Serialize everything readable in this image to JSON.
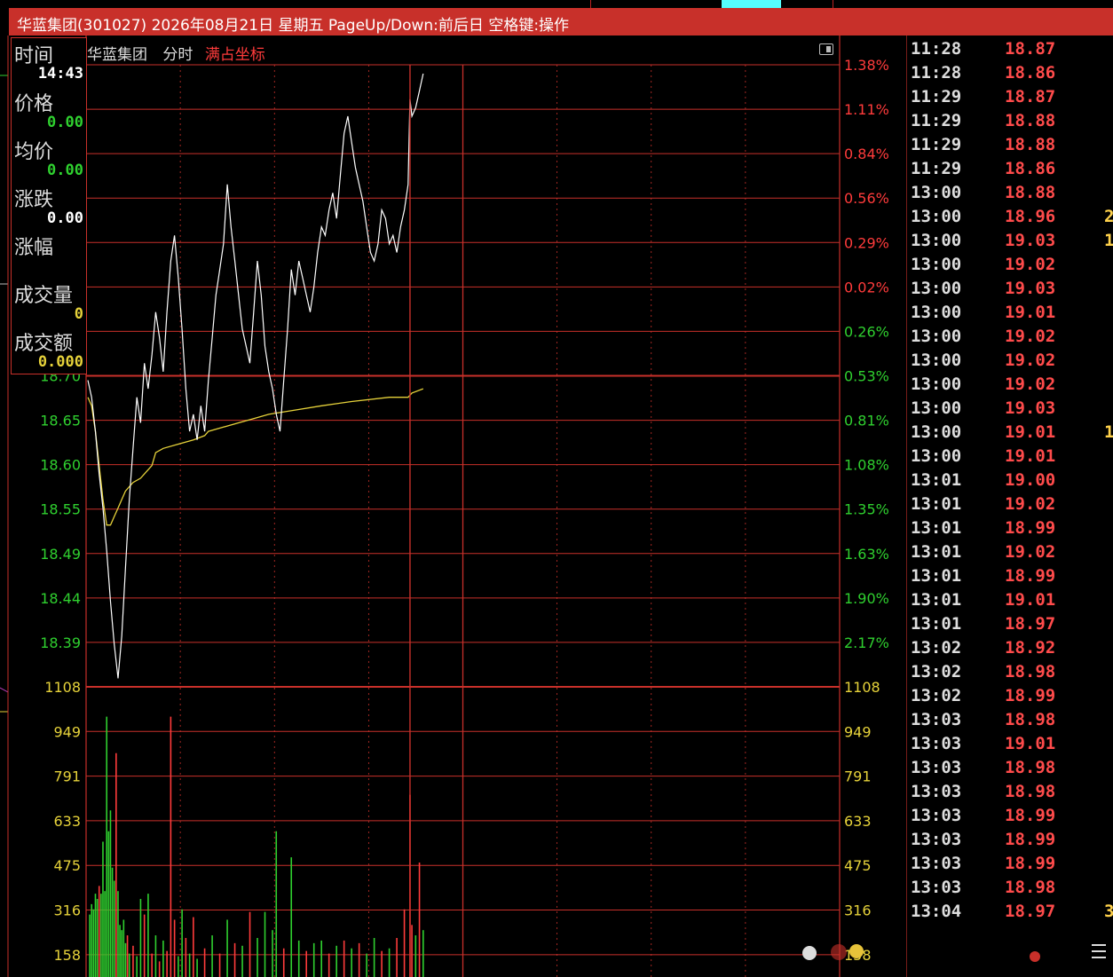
{
  "window": {
    "title": "华蓝集团(301027) 2026年08月21日 星期五 PageUp/Down:前后日 空格键:操作"
  },
  "header": {
    "close_glyph": "×",
    "stock_name": "华蓝集团",
    "view_mode": "分时",
    "coord_mode": "满占坐标"
  },
  "info_panel": {
    "time_label": "时间",
    "time_value": "14:43",
    "price_label": "价格",
    "price_value": "0.00",
    "avg_label": "均价",
    "avg_value": "0.00",
    "change_label": "涨跌",
    "change_value": "0.00",
    "pct_label": "涨幅",
    "pct_value": "",
    "volume_label": "成交量",
    "volume_value": "0",
    "amount_label": "成交额",
    "amount_value": "0.000"
  },
  "colors": {
    "grid": "#c8302a",
    "price_line": "#ffffff",
    "avg_line": "#e6d23a",
    "up": "#ff3b3b",
    "down": "#2fd02f",
    "axis_text_green": "#2fd02f",
    "axis_text_yellow": "#e6d23a",
    "axis_text_red": "#ff3b3b"
  },
  "chart_data": {
    "type": "line",
    "price_axis_left": [
      "18.70",
      "18.65",
      "18.60",
      "18.55",
      "18.49",
      "18.44",
      "18.39"
    ],
    "pct_axis_right_up": [
      "1.38%",
      "1.11%",
      "0.84%",
      "0.56%",
      "0.29%",
      "0.02%"
    ],
    "pct_axis_right_down": [
      "0.26%",
      "0.53%",
      "0.81%",
      "1.08%",
      "1.35%",
      "1.63%",
      "1.90%",
      "2.17%"
    ],
    "volume_axis": [
      "1108",
      "949",
      "791",
      "633",
      "475",
      "316",
      "158"
    ],
    "price_range": [
      18.36,
      19.08
    ],
    "volume_range": [
      0,
      1108
    ],
    "price_series": [
      [
        0,
        18.72
      ],
      [
        2,
        18.7
      ],
      [
        4,
        18.66
      ],
      [
        6,
        18.61
      ],
      [
        8,
        18.57
      ],
      [
        10,
        18.52
      ],
      [
        12,
        18.46
      ],
      [
        14,
        18.41
      ],
      [
        16,
        18.37
      ],
      [
        18,
        18.42
      ],
      [
        20,
        18.5
      ],
      [
        22,
        18.58
      ],
      [
        24,
        18.64
      ],
      [
        26,
        18.7
      ],
      [
        28,
        18.67
      ],
      [
        30,
        18.74
      ],
      [
        32,
        18.71
      ],
      [
        34,
        18.75
      ],
      [
        36,
        18.8
      ],
      [
        38,
        18.77
      ],
      [
        40,
        18.73
      ],
      [
        42,
        18.8
      ],
      [
        44,
        18.86
      ],
      [
        46,
        18.89
      ],
      [
        48,
        18.84
      ],
      [
        50,
        18.78
      ],
      [
        52,
        18.71
      ],
      [
        54,
        18.66
      ],
      [
        56,
        18.68
      ],
      [
        58,
        18.65
      ],
      [
        60,
        18.69
      ],
      [
        62,
        18.66
      ],
      [
        64,
        18.72
      ],
      [
        66,
        18.77
      ],
      [
        68,
        18.82
      ],
      [
        70,
        18.85
      ],
      [
        72,
        18.88
      ],
      [
        74,
        18.95
      ],
      [
        76,
        18.9
      ],
      [
        78,
        18.86
      ],
      [
        80,
        18.82
      ],
      [
        82,
        18.78
      ],
      [
        84,
        18.76
      ],
      [
        86,
        18.74
      ],
      [
        88,
        18.8
      ],
      [
        90,
        18.86
      ],
      [
        92,
        18.82
      ],
      [
        94,
        18.76
      ],
      [
        96,
        18.73
      ],
      [
        98,
        18.71
      ],
      [
        100,
        18.68
      ],
      [
        102,
        18.66
      ],
      [
        104,
        18.72
      ],
      [
        106,
        18.78
      ],
      [
        108,
        18.85
      ],
      [
        110,
        18.82
      ],
      [
        112,
        18.86
      ],
      [
        114,
        18.84
      ],
      [
        116,
        18.82
      ],
      [
        118,
        18.8
      ],
      [
        120,
        18.83
      ],
      [
        122,
        18.87
      ],
      [
        124,
        18.9
      ],
      [
        126,
        18.89
      ],
      [
        128,
        18.92
      ],
      [
        130,
        18.94
      ],
      [
        132,
        18.91
      ],
      [
        134,
        18.96
      ],
      [
        136,
        19.01
      ],
      [
        138,
        19.03
      ],
      [
        140,
        19.0
      ],
      [
        142,
        18.97
      ],
      [
        144,
        18.95
      ],
      [
        146,
        18.93
      ],
      [
        148,
        18.9
      ],
      [
        150,
        18.87
      ],
      [
        152,
        18.86
      ],
      [
        154,
        18.88
      ],
      [
        156,
        18.92
      ],
      [
        158,
        18.91
      ],
      [
        160,
        18.88
      ],
      [
        162,
        18.89
      ],
      [
        164,
        18.87
      ],
      [
        166,
        18.9
      ],
      [
        168,
        18.92
      ],
      [
        170,
        18.95
      ],
      [
        171,
        19.05
      ],
      [
        172,
        19.03
      ],
      [
        174,
        19.04
      ],
      [
        176,
        19.06
      ],
      [
        178,
        19.08
      ]
    ],
    "avg_series": [
      [
        0,
        18.7
      ],
      [
        2,
        18.69
      ],
      [
        4,
        18.66
      ],
      [
        6,
        18.62
      ],
      [
        8,
        18.58
      ],
      [
        10,
        18.55
      ],
      [
        12,
        18.55
      ],
      [
        14,
        18.56
      ],
      [
        16,
        18.57
      ],
      [
        18,
        18.58
      ],
      [
        20,
        18.59
      ],
      [
        24,
        18.6
      ],
      [
        28,
        18.605
      ],
      [
        30,
        18.61
      ],
      [
        34,
        18.62
      ],
      [
        36,
        18.635
      ],
      [
        40,
        18.64
      ],
      [
        48,
        18.645
      ],
      [
        56,
        18.65
      ],
      [
        62,
        18.655
      ],
      [
        64,
        18.66
      ],
      [
        72,
        18.665
      ],
      [
        80,
        18.67
      ],
      [
        88,
        18.675
      ],
      [
        96,
        18.68
      ],
      [
        110,
        18.685
      ],
      [
        124,
        18.69
      ],
      [
        140,
        18.695
      ],
      [
        160,
        18.7
      ],
      [
        170,
        18.7
      ],
      [
        172,
        18.705
      ],
      [
        178,
        18.71
      ]
    ],
    "volume_bars": [
      [
        1,
        240,
        "down"
      ],
      [
        2,
        280,
        "down"
      ],
      [
        3,
        260,
        "down"
      ],
      [
        4,
        320,
        "down"
      ],
      [
        5,
        300,
        "down"
      ],
      [
        6,
        350,
        "up"
      ],
      [
        7,
        320,
        "down"
      ],
      [
        8,
        520,
        "down"
      ],
      [
        9,
        330,
        "down"
      ],
      [
        10,
        1000,
        "down"
      ],
      [
        11,
        560,
        "down"
      ],
      [
        12,
        640,
        "down"
      ],
      [
        13,
        420,
        "down"
      ],
      [
        14,
        370,
        "down"
      ],
      [
        15,
        860,
        "up"
      ],
      [
        16,
        330,
        "down"
      ],
      [
        17,
        200,
        "down"
      ],
      [
        18,
        180,
        "down"
      ],
      [
        19,
        220,
        "down"
      ],
      [
        20,
        130,
        "down"
      ],
      [
        21,
        160,
        "up"
      ],
      [
        22,
        90,
        "down"
      ],
      [
        24,
        120,
        "up"
      ],
      [
        26,
        80,
        "down"
      ],
      [
        28,
        300,
        "down"
      ],
      [
        30,
        240,
        "up"
      ],
      [
        32,
        320,
        "down"
      ],
      [
        34,
        90,
        "up"
      ],
      [
        36,
        160,
        "down"
      ],
      [
        38,
        60,
        "up"
      ],
      [
        40,
        140,
        "down"
      ],
      [
        42,
        100,
        "up"
      ],
      [
        44,
        1000,
        "up"
      ],
      [
        46,
        220,
        "up"
      ],
      [
        48,
        80,
        "down"
      ],
      [
        50,
        260,
        "down"
      ],
      [
        52,
        150,
        "up"
      ],
      [
        54,
        90,
        "down"
      ],
      [
        56,
        230,
        "up"
      ],
      [
        58,
        70,
        "down"
      ],
      [
        62,
        110,
        "up"
      ],
      [
        66,
        160,
        "down"
      ],
      [
        70,
        90,
        "up"
      ],
      [
        74,
        220,
        "down"
      ],
      [
        78,
        130,
        "up"
      ],
      [
        82,
        120,
        "down"
      ],
      [
        86,
        250,
        "up"
      ],
      [
        90,
        150,
        "down"
      ],
      [
        94,
        250,
        "down"
      ],
      [
        98,
        180,
        "down"
      ],
      [
        100,
        560,
        "down"
      ],
      [
        104,
        110,
        "up"
      ],
      [
        108,
        460,
        "down"
      ],
      [
        112,
        140,
        "down"
      ],
      [
        116,
        100,
        "up"
      ],
      [
        120,
        130,
        "down"
      ],
      [
        124,
        140,
        "down"
      ],
      [
        128,
        90,
        "up"
      ],
      [
        132,
        120,
        "down"
      ],
      [
        136,
        140,
        "up"
      ],
      [
        140,
        110,
        "down"
      ],
      [
        144,
        130,
        "up"
      ],
      [
        148,
        90,
        "down"
      ],
      [
        152,
        150,
        "down"
      ],
      [
        156,
        100,
        "up"
      ],
      [
        160,
        110,
        "down"
      ],
      [
        164,
        150,
        "up"
      ],
      [
        168,
        260,
        "up"
      ],
      [
        171,
        700,
        "up"
      ],
      [
        172,
        200,
        "up"
      ],
      [
        174,
        160,
        "down"
      ],
      [
        176,
        440,
        "up"
      ],
      [
        178,
        180,
        "down"
      ]
    ]
  },
  "ticks": [
    {
      "time": "11:28",
      "price": "18.87",
      "vol": ""
    },
    {
      "time": "11:28",
      "price": "18.86",
      "vol": ""
    },
    {
      "time": "11:29",
      "price": "18.87",
      "vol": ""
    },
    {
      "time": "11:29",
      "price": "18.88",
      "vol": ""
    },
    {
      "time": "11:29",
      "price": "18.88",
      "vol": ""
    },
    {
      "time": "11:29",
      "price": "18.86",
      "vol": ""
    },
    {
      "time": "13:00",
      "price": "18.88",
      "vol": ""
    },
    {
      "time": "13:00",
      "price": "18.96",
      "vol": "2"
    },
    {
      "time": "13:00",
      "price": "19.03",
      "vol": "1"
    },
    {
      "time": "13:00",
      "price": "19.02",
      "vol": ""
    },
    {
      "time": "13:00",
      "price": "19.03",
      "vol": ""
    },
    {
      "time": "13:00",
      "price": "19.01",
      "vol": ""
    },
    {
      "time": "13:00",
      "price": "19.02",
      "vol": ""
    },
    {
      "time": "13:00",
      "price": "19.02",
      "vol": ""
    },
    {
      "time": "13:00",
      "price": "19.02",
      "vol": ""
    },
    {
      "time": "13:00",
      "price": "19.03",
      "vol": ""
    },
    {
      "time": "13:00",
      "price": "19.01",
      "vol": "1"
    },
    {
      "time": "13:00",
      "price": "19.01",
      "vol": ""
    },
    {
      "time": "13:01",
      "price": "19.00",
      "vol": ""
    },
    {
      "time": "13:01",
      "price": "19.02",
      "vol": ""
    },
    {
      "time": "13:01",
      "price": "18.99",
      "vol": ""
    },
    {
      "time": "13:01",
      "price": "19.02",
      "vol": ""
    },
    {
      "time": "13:01",
      "price": "18.99",
      "vol": ""
    },
    {
      "time": "13:01",
      "price": "19.01",
      "vol": ""
    },
    {
      "time": "13:01",
      "price": "18.97",
      "vol": ""
    },
    {
      "time": "13:02",
      "price": "18.92",
      "vol": ""
    },
    {
      "time": "13:02",
      "price": "18.98",
      "vol": ""
    },
    {
      "time": "13:02",
      "price": "18.99",
      "vol": ""
    },
    {
      "time": "13:03",
      "price": "18.98",
      "vol": ""
    },
    {
      "time": "13:03",
      "price": "19.01",
      "vol": ""
    },
    {
      "time": "13:03",
      "price": "18.98",
      "vol": ""
    },
    {
      "time": "13:03",
      "price": "18.98",
      "vol": ""
    },
    {
      "time": "13:03",
      "price": "18.99",
      "vol": ""
    },
    {
      "time": "13:03",
      "price": "18.99",
      "vol": ""
    },
    {
      "time": "13:03",
      "price": "18.99",
      "vol": ""
    },
    {
      "time": "13:03",
      "price": "18.98",
      "vol": ""
    },
    {
      "time": "13:04",
      "price": "18.97",
      "vol": "3"
    }
  ]
}
